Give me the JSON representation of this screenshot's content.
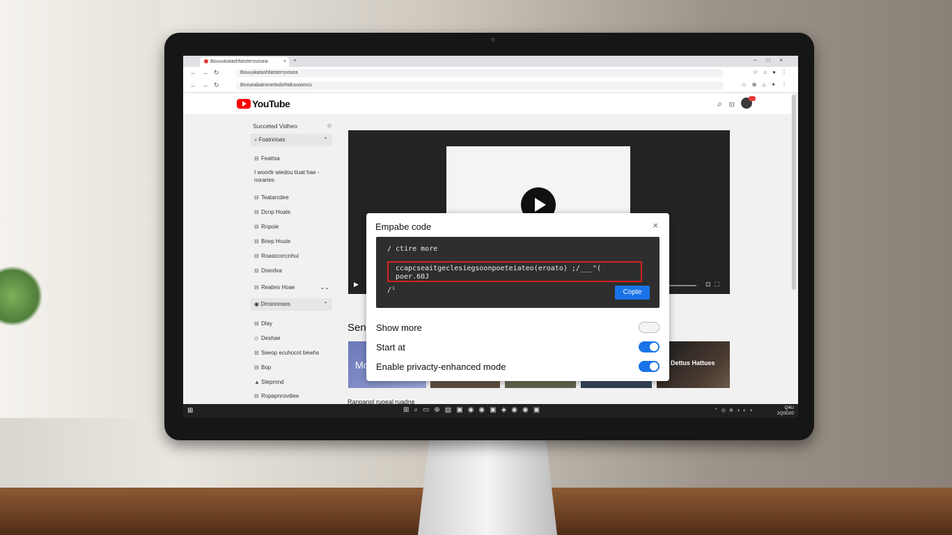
{
  "browser": {
    "tab_title": "Bouuukatashfatsterssosea",
    "tab_close": "×",
    "new_tab": "+",
    "window_controls": "–□×",
    "url_1": "Bouuukatashfatsterssosea",
    "url_2": "Bnsseabatronerbobrhtdcooiomcs",
    "nav_glyphs": "←→↻",
    "right_icons_1": "☆⌂●⋮",
    "right_icons_2": "☆⊕⌂✦⋮"
  },
  "youtube": {
    "logo_text": "YouTube",
    "header_icons": "⌕⊡✦"
  },
  "sidebar": {
    "title": "Succeted Vidheo",
    "star": "☆",
    "sections": [
      {
        "label": "Foatnrioas",
        "chevron": "⌃"
      },
      {
        "label": "Drnsnnnses",
        "chevron": "⌃"
      }
    ],
    "items_a": [
      {
        "icon": "⊟",
        "label": "Feattsa"
      },
      {
        "icon": "",
        "label": "I woortk wiedou tiuat hae -\nnoraries"
      },
      {
        "icon": "⊟",
        "label": "Teatarcdee"
      },
      {
        "icon": "⊟",
        "label": "Dcnp Hoate"
      },
      {
        "icon": "⊟",
        "label": "Rnpoie"
      },
      {
        "icon": "⊟",
        "label": "Bnep Houte"
      },
      {
        "icon": "⊟",
        "label": "Roastcorrcnhui"
      },
      {
        "icon": "⊟",
        "label": "Dserdva"
      },
      {
        "icon": "⊟",
        "label": "Reaties Hoae"
      }
    ],
    "items_b": [
      {
        "icon": "⊟",
        "label": "Dlay"
      },
      {
        "icon": "◇",
        "label": "Deshae"
      },
      {
        "icon": "⊟",
        "label": "Seeop ecuhocnt bewhs"
      },
      {
        "icon": "⊟",
        "label": "Bop"
      },
      {
        "icon": "▲",
        "label": "Steprnnd"
      },
      {
        "icon": "⊟",
        "label": "Ropapnrovdiee"
      }
    ],
    "collapse_glyph": "⌄⌄"
  },
  "player": {
    "play_glyph": "▶",
    "right_ctl": "⊡⛶"
  },
  "content": {
    "section_heading": "Sen",
    "thumb1_text": "Mo",
    "thumb5_text": "o Dettus Hattues",
    "below_text": "Ranpanol ruoeal ruadne"
  },
  "modal": {
    "title": "Empabe code",
    "close": "×",
    "code_line_1": "/ ctire more",
    "code_line_2": "ccapcseaitgeclesiegsoonpoeteiateo(eroato) ;/___\"(\npoer.60J",
    "code_line_3": "/¹",
    "copy_label": "Copte",
    "options": [
      {
        "label": "Show more",
        "state": "off"
      },
      {
        "label": "Start at",
        "state": "on"
      },
      {
        "label": "Enable privacty-enhanced mode",
        "state": "on"
      }
    ]
  },
  "taskbar": {
    "start": "⊞",
    "apps": "⊞⌕▭⊕▤▣◉◉▣◈◉◉▣",
    "tray": "⌃◎⊕◑◐◖",
    "clock_line1": "Q4U",
    "clock_line2": "2Q0D20"
  },
  "colors": {
    "accent": "#1a73e8",
    "youtube_red": "#ff0000",
    "highlight": "#d81f1f"
  }
}
